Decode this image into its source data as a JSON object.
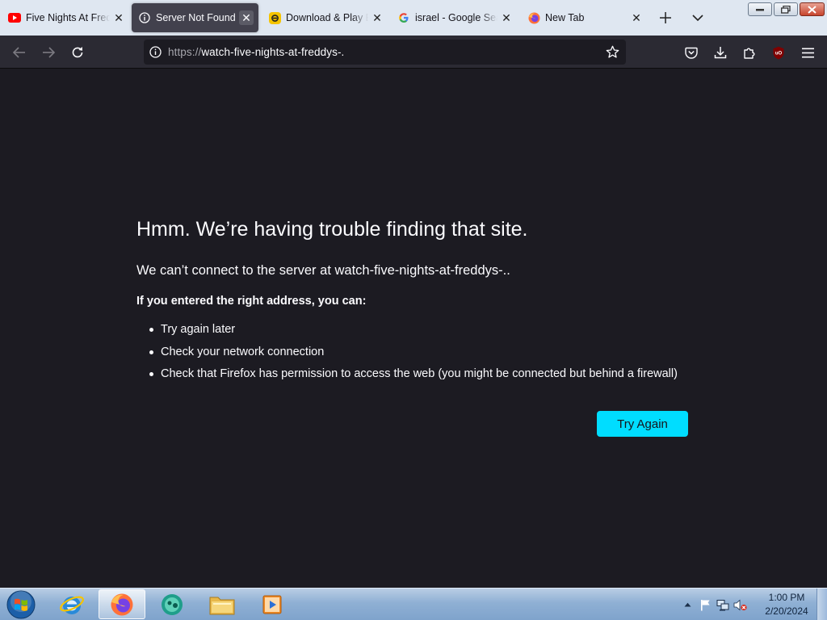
{
  "browser": {
    "tabs": [
      {
        "title": "Five Nights At Fredd",
        "icon": "youtube-icon",
        "active": false
      },
      {
        "title": "Server Not Found",
        "icon": "info-icon",
        "active": true
      },
      {
        "title": "Download & Play B",
        "icon": "app-store-icon",
        "active": false
      },
      {
        "title": "israel - Google Sear",
        "icon": "google-icon",
        "active": false
      },
      {
        "title": "New Tab",
        "icon": "firefox-icon",
        "active": false
      }
    ],
    "url_scheme": "https://",
    "url_host": "watch-five-nights-at-freddys-."
  },
  "page": {
    "title": "Hmm. We’re having trouble finding that site.",
    "short_desc": "We can’t connect to the server at watch-five-nights-at-freddys-..",
    "suggestions_heading": "If you entered the right address, you can:",
    "suggestions": [
      "Try again later",
      "Check your network connection",
      "Check that Firefox has permission to access the web (you might be connected but behind a firewall)"
    ],
    "try_again_label": "Try Again"
  },
  "taskbar": {
    "apps": [
      "internet-explorer-icon",
      "firefox-icon",
      "messenger-icon",
      "file-explorer-icon",
      "media-player-icon"
    ],
    "clock_time": "1:00 PM",
    "clock_date": "2/20/2024"
  },
  "colors": {
    "page_bg": "#1c1b22",
    "toolbar_bg": "#2b2a33",
    "accent_button": "#00ddff",
    "tabstrip_bg": "#dfe7f1"
  }
}
